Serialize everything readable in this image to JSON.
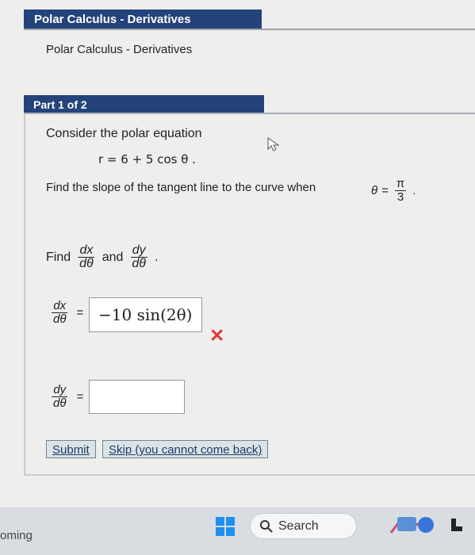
{
  "header": {
    "title": "Polar Calculus - Derivatives",
    "subtitle": "Polar Calculus - Derivatives"
  },
  "part": {
    "label": "Part 1 of 2"
  },
  "question": {
    "intro": "Consider the polar equation",
    "equation": "r = 6 + 5 cos θ .",
    "slope_prompt": "Find the slope of the tangent line to the curve when",
    "theta_symbol": "θ",
    "equals": "=",
    "theta_num": "π",
    "theta_den": "3",
    "theta_end": ".",
    "find_word": "Find",
    "and_word": "and",
    "dx_num": "dx",
    "dy_num": "dy",
    "dtheta": "dθ",
    "period": "."
  },
  "answers": {
    "dx_value": "−10 sin(2θ)",
    "dx_status": "incorrect",
    "dy_value": ""
  },
  "buttons": {
    "submit": "Submit",
    "skip": "Skip (you cannot come back)"
  },
  "taskbar": {
    "left_text": "oming",
    "search_label": "Search"
  },
  "colors": {
    "header_bg": "#24437a",
    "error": "#e2383b",
    "windows_blue": "#1f8ff0"
  }
}
